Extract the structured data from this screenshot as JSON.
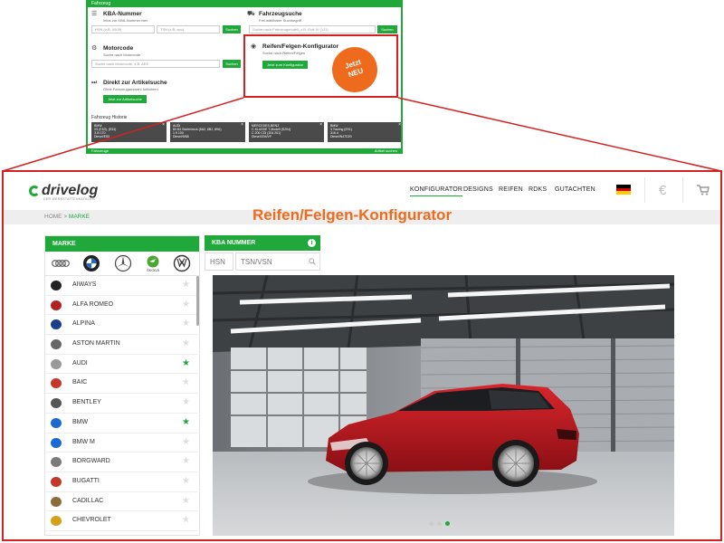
{
  "mini": {
    "topbar": "Fahrzeug",
    "kba": {
      "title": "KBA-Nummer",
      "sub": "Infos zur KBA-Nummer hier",
      "hsn_ph": "HSN (z.B. 0005)",
      "tsn_ph": "TSN (z.B. acu)",
      "btn": "Suchen"
    },
    "vehicle_search": {
      "title": "Fahrzeugsuche",
      "sub": "Frei wählbarer Suchbegriff",
      "ph": "Suche nach Fahrzeugmodell, z.B. Golf IV (1J1)",
      "btn": "Suchen"
    },
    "motorcode": {
      "title": "Motorcode",
      "sub": "Suche nach Motorcode",
      "ph": "Suche nach Motorcode, z.B. AEE",
      "btn": "Suchen"
    },
    "configurator": {
      "title": "Reifen/Felgen-Konfigurator",
      "sub": "Suche nach Reifen/Felgen",
      "btn": "Jetzt zum Konfigurator"
    },
    "articles": {
      "title": "Direkt zur Artikelsuche",
      "sub": "Ohne Fahrzeugauswahl fortfahren",
      "btn": "Jetzt zur Artikelsuche"
    },
    "history": {
      "title": "Fahrzeug Historie",
      "cards": [
        {
          "l1": "BMW",
          "l2": "X5 (E53), (E53)",
          "l3": "3.0i 170",
          "l4": "Diesel/E53"
        },
        {
          "l1": "AUDI",
          "l2": "80 B4 Stufenheck (8A2, 8B2, 89A)",
          "l3": "1.9 100",
          "l4": "Diesel/9/68"
        },
        {
          "l1": "MERCEDES-BENZ",
          "l2": "C-KLASSE T-Modell (S204)",
          "l3": "C 200 CDI (204.201)",
          "l4": "Diesel/204/VF"
        },
        {
          "l1": "BMW",
          "l2": "3 Touring (E91)",
          "l3": "316 d",
          "l4": "Diesel/N47D20"
        }
      ]
    },
    "bottombar_left": "Fahrzeuge",
    "bottombar_right": "Artikel suchen"
  },
  "badge": {
    "line1": "Jetzt",
    "line2": "NEU"
  },
  "header": {
    "logo_text": "drivelog",
    "logo_tag": "DER WERKSTATTENKATALOG",
    "nav": [
      "KONFIGURATOR",
      "DESIGNS",
      "REIFEN",
      "RDKS",
      "GUTACHTEN"
    ],
    "currency": "€"
  },
  "breadcrumb": {
    "home": "HOME",
    "sep": ">",
    "current": "MARKE"
  },
  "page_title": "Reifen/Felgen-Konfigurator",
  "marke": {
    "header": "MARKE",
    "quick_brands": [
      "audi-logo",
      "bmw-logo",
      "mercedes-logo",
      "skoda-logo",
      "vw-logo"
    ],
    "skoda_label": "ŠKODA",
    "brands": [
      {
        "name": "AIWAYS",
        "fav": false,
        "color": "#222222"
      },
      {
        "name": "ALFA ROMEO",
        "fav": false,
        "color": "#b22222"
      },
      {
        "name": "ALPINA",
        "fav": false,
        "color": "#1a3f8b"
      },
      {
        "name": "ASTON MARTIN",
        "fav": false,
        "color": "#666666"
      },
      {
        "name": "AUDI",
        "fav": true,
        "color": "#999999"
      },
      {
        "name": "BAIC",
        "fav": false,
        "color": "#c0392b"
      },
      {
        "name": "BENTLEY",
        "fav": false,
        "color": "#555555"
      },
      {
        "name": "BMW",
        "fav": true,
        "color": "#1c69d4"
      },
      {
        "name": "BMW M",
        "fav": false,
        "color": "#1c69d4"
      },
      {
        "name": "BORGWARD",
        "fav": false,
        "color": "#7a7a7a"
      },
      {
        "name": "BUGATTI",
        "fav": false,
        "color": "#c0392b"
      },
      {
        "name": "CADILLAC",
        "fav": false,
        "color": "#8a6d3b"
      },
      {
        "name": "CHEVROLET",
        "fav": false,
        "color": "#d4a017"
      }
    ]
  },
  "kba": {
    "header": "KBA NUMMER",
    "info": "i",
    "hsn_placeholder": "HSN",
    "tsn_placeholder": "TSN/VSN"
  },
  "carousel": {
    "slides": 3,
    "active": 3
  },
  "colors": {
    "green": "#20a83a",
    "orange": "#ee6a1d",
    "red": "#d42020"
  }
}
